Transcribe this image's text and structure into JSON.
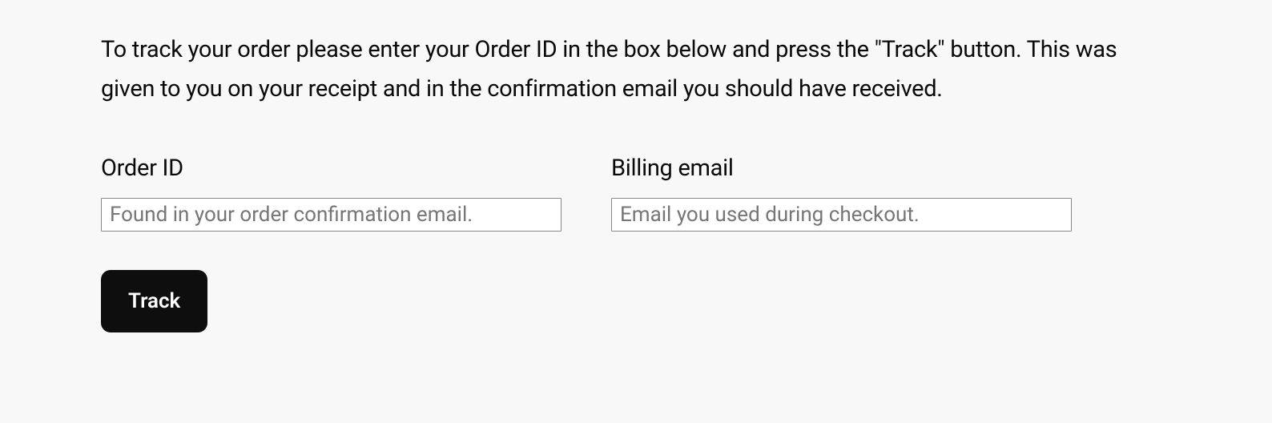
{
  "instructions": "To track your order please enter your Order ID in the box below and press the \"Track\" button. This was given to you on your receipt and in the confirmation email you should have received.",
  "form": {
    "order_id": {
      "label": "Order ID",
      "placeholder": "Found in your order confirmation email.",
      "value": ""
    },
    "billing_email": {
      "label": "Billing email",
      "placeholder": "Email you used during checkout.",
      "value": ""
    },
    "submit_label": "Track"
  }
}
